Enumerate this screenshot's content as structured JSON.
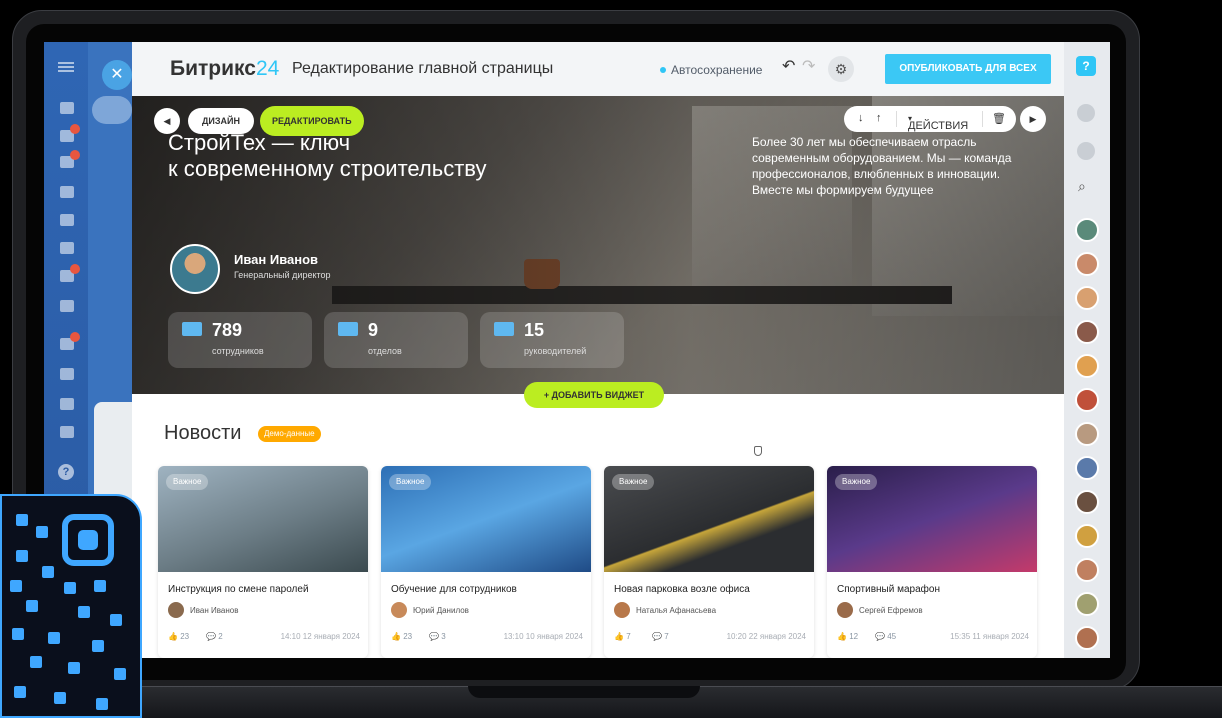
{
  "app": {
    "logo_main": "Битрикс",
    "logo_num": "24",
    "page_title": "Редактирование главной страницы",
    "autosave": "Автосохранение",
    "publish": "ОПУБЛИКОВАТЬ ДЛЯ ВСЕХ"
  },
  "hero": {
    "design": "ДИЗАЙН",
    "edit": "РЕДАКТИРОВАТЬ",
    "title_line1": "СтройТех — ключ",
    "title_line2": "к современному строительству",
    "description": "Более 30 лет мы обеспечиваем отрасль современным оборудованием. Мы — команда профессионалов, влюбленных в инновации. Вместе мы формируем будущее",
    "actions": "ДЕЙСТВИЯ",
    "person_name": "Иван Иванов",
    "person_role": "Генеральный директор",
    "stats": [
      {
        "value": "789",
        "label": "сотрудников"
      },
      {
        "value": "9",
        "label": "отделов"
      },
      {
        "value": "15",
        "label": "руководителей"
      }
    ],
    "add_widget": "ДОБАВИТЬ ВИДЖЕТ"
  },
  "news": {
    "title": "Новости",
    "badge": "Демо-данные",
    "cards": [
      {
        "tag": "Важное",
        "title": "Инструкция по смене паролей",
        "author": "Иван Иванов",
        "likes": "23",
        "comments": "2",
        "date": "14:10 12 января 2024"
      },
      {
        "tag": "Важное",
        "title": "Обучение для сотрудников",
        "author": "Юрий Данилов",
        "likes": "23",
        "comments": "3",
        "date": "13:10 10 января 2024"
      },
      {
        "tag": "Важное",
        "title": "Новая парковка возле офиса",
        "author": "Наталья Афанасьева",
        "likes": "7",
        "comments": "7",
        "date": "10:20 22 января 2024"
      },
      {
        "tag": "Важное",
        "title": "Спортивный марафон",
        "author": "Сергей Ефремов",
        "likes": "12",
        "comments": "45",
        "date": "15:35 11 января 2024"
      }
    ]
  },
  "colors": {
    "accent": "#2fc6f6",
    "lime": "#bbed21",
    "badge": "#ffa900",
    "rail": "#2f66b4"
  },
  "icons": [
    "hamburger-icon",
    "close-icon",
    "undo-icon",
    "redo-icon",
    "gear-icon",
    "help-icon",
    "bell-icon",
    "search-icon"
  ]
}
